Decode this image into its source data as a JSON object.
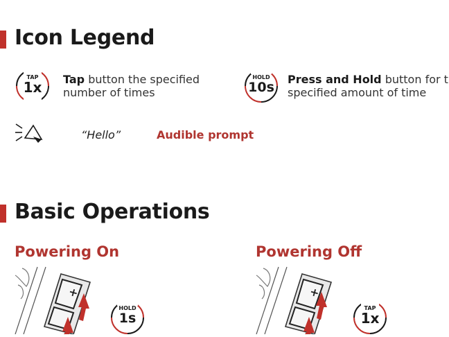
{
  "legend": {
    "title": "Icon Legend",
    "tap": {
      "badge_top": "TAP",
      "badge_main": "1x",
      "bold": "Tap",
      "rest1": " button the specified",
      "line2": "number of times"
    },
    "hold": {
      "badge_top": "HOLD",
      "badge_main": "10s",
      "bold": "Press and Hold",
      "rest1": " button for th",
      "line2": "specified amount of time"
    },
    "audio": {
      "quote": "“Hello”",
      "label": "Audible prompt"
    }
  },
  "basic": {
    "title": "Basic Operations",
    "powering_on": {
      "title": "Powering On",
      "badge_top": "HOLD",
      "badge_main": "1s"
    },
    "powering_off": {
      "title": "Powering Off",
      "badge_top": "TAP",
      "badge_main": "1x"
    }
  },
  "colors": {
    "accent": "#c0312b",
    "text": "#1a1a1a"
  },
  "icons": [
    "speaker-icon",
    "device-illustration"
  ]
}
